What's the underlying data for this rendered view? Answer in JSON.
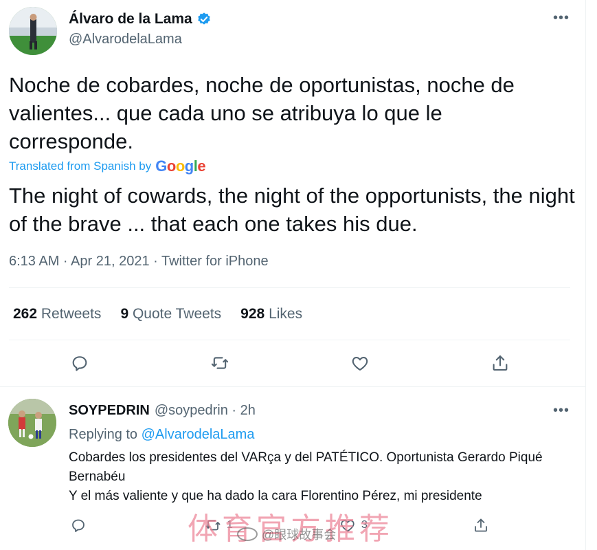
{
  "main_tweet": {
    "author_name": "Álvaro de la Lama",
    "author_handle": "@AlvarodelaLama",
    "text": "Noche de cobardes, noche de oportunistas, noche de valientes... que cada uno se atribuya lo que le corresponde.",
    "translated_label": "Translated from Spanish by",
    "translator_brand": "Google",
    "translated_text": "The night of cowards, the night of the opportunists, the night of the brave ... that each one takes his due.",
    "meta": "6:13 AM · Apr 21, 2021 · Twitter for iPhone",
    "stats": {
      "retweets_count": "262",
      "retweets_label": "Retweets",
      "quotes_count": "9",
      "quotes_label": "Quote Tweets",
      "likes_count": "928",
      "likes_label": "Likes"
    },
    "icons": [
      "reply-icon",
      "retweet-icon",
      "like-icon",
      "share-icon",
      "more-icon",
      "verified-badge-icon"
    ]
  },
  "reply": {
    "author_name": "SOYPEDRIN",
    "author_handle": "@soypedrin · 2h",
    "replying_prefix": "Replying to",
    "replying_to": "@AlvarodelaLama",
    "text_line1": "Cobardes los presidentes del VARça y del PATÉTICO. Oportunista Gerardo Piqué Bernabéu",
    "text_line2": "Y el más valiente y que ha dado la cara Florentino Pérez, mi presidente",
    "retweet_count": "1",
    "like_count": "3"
  },
  "watermark": {
    "overlay_text": "体育官方推荐",
    "weibo_text": "@眼球故事会"
  },
  "colors": {
    "link": "#1d9bf0",
    "text_primary": "#0f1419",
    "text_secondary": "#536471",
    "divider": "#eff3f4"
  }
}
